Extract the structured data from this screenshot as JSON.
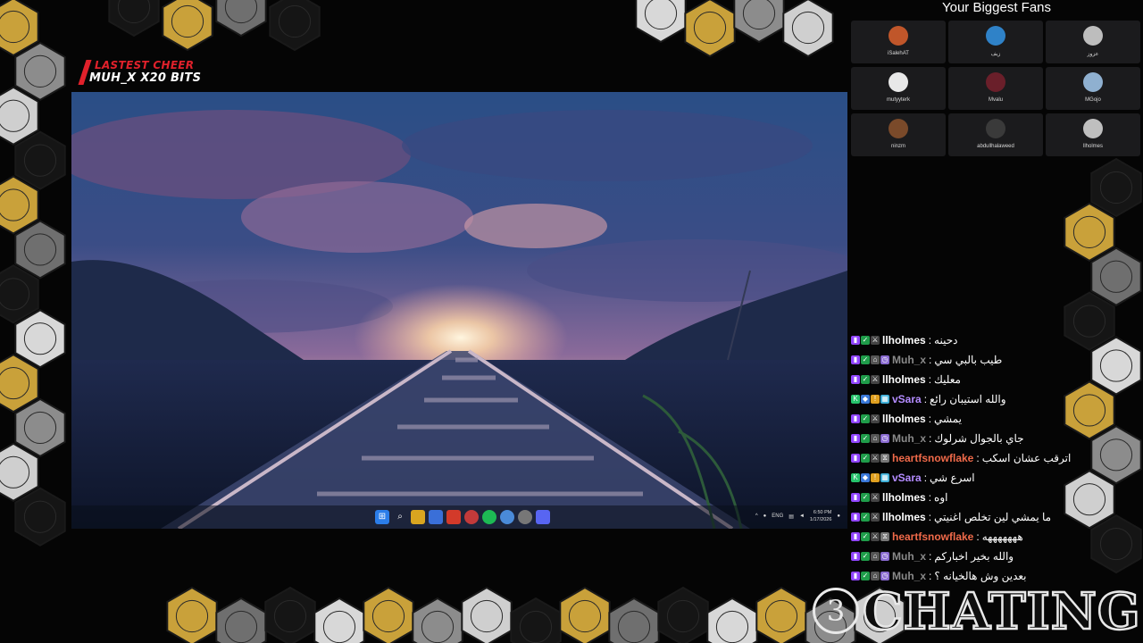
{
  "overlay": {
    "cheer_label": "LASTEST CHEER",
    "cheer_value": "MUH_X X20 BITS",
    "fans_title": "Your Biggest Fans",
    "logo_number": "3",
    "logo_text": "CHATING"
  },
  "fans": [
    {
      "name": "iSalehAT",
      "color": "#c0562a"
    },
    {
      "name": "زيف",
      "color": "#2f82c8"
    },
    {
      "name": "عزوز",
      "color": "#bdbdbd"
    },
    {
      "name": "mutyyterk",
      "color": "#e8e8e8"
    },
    {
      "name": "Mvalu",
      "color": "#6a1f2a"
    },
    {
      "name": "MGojo",
      "color": "#8fb0d0"
    },
    {
      "name": "ninzm",
      "color": "#7a4a2a"
    },
    {
      "name": "abdullhalaweed",
      "color": "#3a3a3a"
    },
    {
      "name": "llholmes",
      "color": "#bfbfbf"
    }
  ],
  "desktop": {
    "taskbar_lang": "ENG",
    "clock_time": "6:50 PM",
    "clock_date": "1/17/2026"
  },
  "chat": [
    {
      "user": "llholmes",
      "color": "#ffffff",
      "badges": [
        "twitch",
        "check",
        "sword"
      ],
      "text": "دحينه"
    },
    {
      "user": "Muh_x",
      "color": "#8a8a8a",
      "badges": [
        "twitch",
        "check",
        "gift",
        "clock"
      ],
      "text": "طيب بالبي سي"
    },
    {
      "user": "llholmes",
      "color": "#ffffff",
      "badges": [
        "twitch",
        "check",
        "sword"
      ],
      "text": "معليك"
    },
    {
      "user": "vSara",
      "color": "#b48cff",
      "badges": [
        "kick",
        "gem",
        "crown",
        "cheer"
      ],
      "text": "والله استيبان رائع"
    },
    {
      "user": "llholmes",
      "color": "#ffffff",
      "badges": [
        "twitch",
        "check",
        "sword"
      ],
      "text": "يمشي"
    },
    {
      "user": "Muh_x",
      "color": "#8a8a8a",
      "badges": [
        "twitch",
        "check",
        "gift",
        "clock"
      ],
      "text": "جاي بالجوال شرلوك"
    },
    {
      "user": "heartfsnowflake",
      "color": "#f06a4a",
      "badges": [
        "twitch",
        "check",
        "sword",
        "bits"
      ],
      "text": "اترقب عشان اسكب"
    },
    {
      "user": "vSara",
      "color": "#b48cff",
      "badges": [
        "kick",
        "gem",
        "crown",
        "cheer"
      ],
      "text": "اسرع شي"
    },
    {
      "user": "llholmes",
      "color": "#ffffff",
      "badges": [
        "twitch",
        "check",
        "sword"
      ],
      "text": "اوه"
    },
    {
      "user": "llholmes",
      "color": "#ffffff",
      "badges": [
        "twitch",
        "check",
        "sword"
      ],
      "text": "ما يمشي لين تخلص اغنيتي"
    },
    {
      "user": "heartfsnowflake",
      "color": "#f06a4a",
      "badges": [
        "twitch",
        "check",
        "sword",
        "bits"
      ],
      "text": "هههههههه"
    },
    {
      "user": "Muh_x",
      "color": "#8a8a8a",
      "badges": [
        "twitch",
        "check",
        "gift",
        "clock"
      ],
      "text": "والله بخير اخباركم"
    },
    {
      "user": "Muh_x",
      "color": "#8a8a8a",
      "badges": [
        "twitch",
        "check",
        "gift",
        "clock"
      ],
      "text": "بعدين وش هالخيانه ؟"
    }
  ],
  "colors": {
    "accent_red": "#e0212b",
    "hex_gold": "#c9a13a",
    "hex_grey": "#8c8c8c"
  }
}
